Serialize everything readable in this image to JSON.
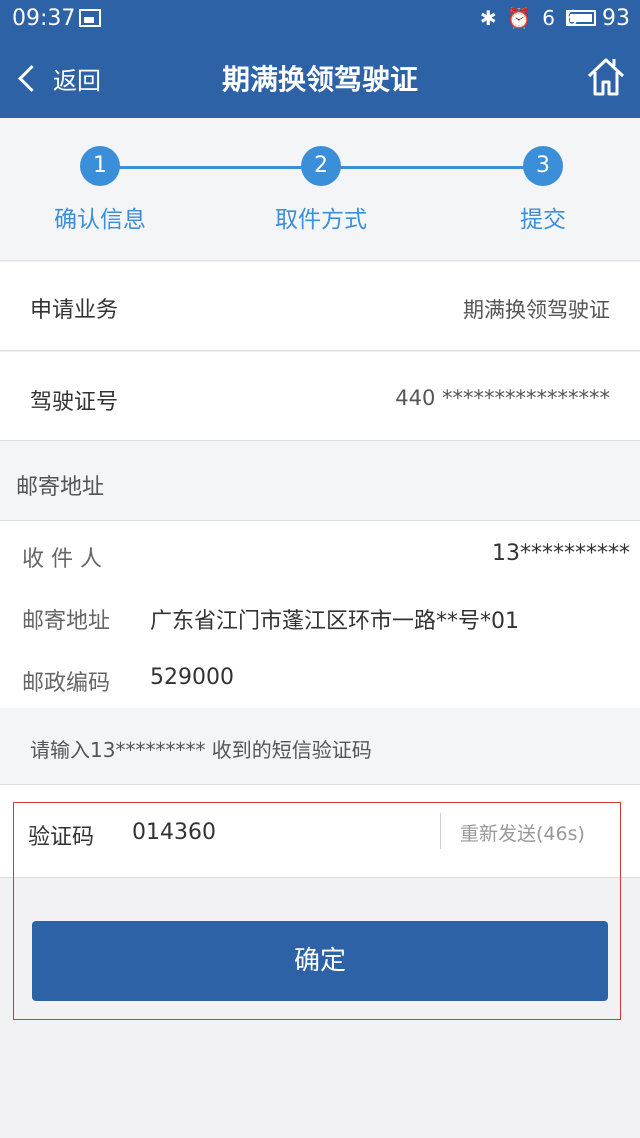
{
  "status": {
    "time": "09:37",
    "signal_text": "✱ ⏰ 6  6",
    "battery": "93"
  },
  "nav": {
    "back_label": "返回",
    "title": "期满换领驾驶证"
  },
  "steps": [
    {
      "num": "1",
      "label": "确认信息"
    },
    {
      "num": "2",
      "label": "取件方式"
    },
    {
      "num": "3",
      "label": "提交"
    }
  ],
  "info": {
    "business_key": "申请业务",
    "business_value": "期满换领驾驶证",
    "license_key": "驾驶证号",
    "license_value": "440 ****************"
  },
  "mail": {
    "header": "邮寄地址",
    "recipient_key": "收 件 人",
    "recipient_value": "13**********",
    "address_key": "邮寄地址",
    "address_value": "广东省江门市蓬江区环市一路**号*01",
    "postcode_key": "邮政编码",
    "postcode_value": "529000"
  },
  "sms": {
    "hint": "请输入13********* 收到的短信验证码",
    "code_key": "验证码",
    "code_value": "014360",
    "resend": "重新发送(46s)"
  },
  "confirm_label": "确定",
  "colors": {
    "primary": "#2d62a7",
    "accent": "#3b8fd9",
    "highlight": "#d23a3a"
  }
}
